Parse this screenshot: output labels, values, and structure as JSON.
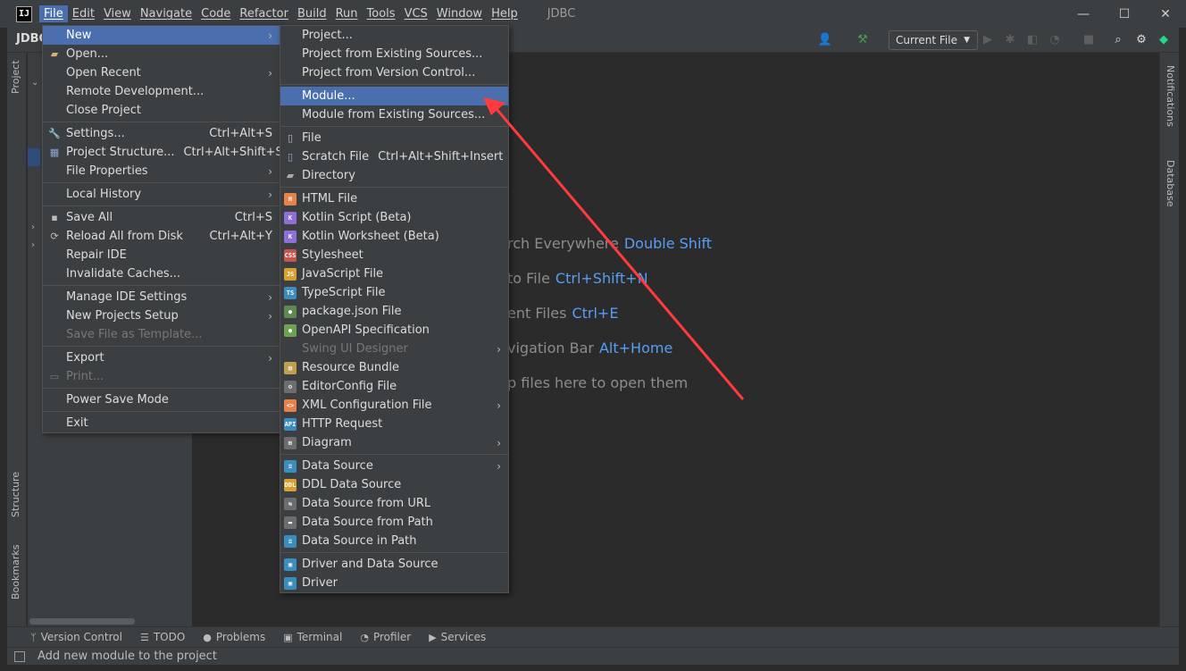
{
  "app": {
    "logo_text": "IJ",
    "window_title": "JDBC",
    "menus": [
      "File",
      "Edit",
      "View",
      "Navigate",
      "Code",
      "Refactor",
      "Build",
      "Run",
      "Tools",
      "VCS",
      "Window",
      "Help"
    ],
    "window_controls": {
      "minimize": "—",
      "maximize": "☐",
      "close": "✕"
    }
  },
  "toolbar": {
    "project_name": "JDBC",
    "run_config": "Current File"
  },
  "side_tabs": {
    "project": "Project",
    "structure": "Structure",
    "bookmarks": "Bookmarks",
    "notifications": "Notifications",
    "database": "Database"
  },
  "welcome_hints": [
    {
      "text": "rch Everywhere",
      "key": "Double Shift"
    },
    {
      "text": "to File",
      "key": "Ctrl+Shift+N"
    },
    {
      "text": "ent Files",
      "key": "Ctrl+E"
    },
    {
      "text": "vigation Bar",
      "key": "Alt+Home"
    },
    {
      "text": "p files here to open them",
      "key": ""
    }
  ],
  "file_menu": {
    "items": [
      {
        "label": "New",
        "shortcut": "",
        "submenu": true,
        "icon": "none",
        "selected": true
      },
      {
        "label": "Open...",
        "shortcut": "",
        "icon": "folder-icon"
      },
      {
        "label": "Open Recent",
        "shortcut": "",
        "submenu": true,
        "icon": "none"
      },
      {
        "label": "Remote Development...",
        "shortcut": "",
        "icon": "none"
      },
      {
        "label": "Close Project",
        "shortcut": "",
        "icon": "none"
      },
      {
        "sep": true
      },
      {
        "label": "Settings...",
        "shortcut": "Ctrl+Alt+S",
        "icon": "wrench-icon"
      },
      {
        "label": "Project Structure...",
        "shortcut": "Ctrl+Alt+Shift+S",
        "icon": "project-structure-icon"
      },
      {
        "label": "File Properties",
        "shortcut": "",
        "submenu": true,
        "icon": "none"
      },
      {
        "sep": true
      },
      {
        "label": "Local History",
        "shortcut": "",
        "submenu": true,
        "icon": "none"
      },
      {
        "sep": true
      },
      {
        "label": "Save All",
        "shortcut": "Ctrl+S",
        "icon": "save-icon"
      },
      {
        "label": "Reload All from Disk",
        "shortcut": "Ctrl+Alt+Y",
        "icon": "reload-icon"
      },
      {
        "label": "Repair IDE",
        "shortcut": "",
        "icon": "none"
      },
      {
        "label": "Invalidate Caches...",
        "shortcut": "",
        "icon": "none"
      },
      {
        "sep": true
      },
      {
        "label": "Manage IDE Settings",
        "shortcut": "",
        "submenu": true,
        "icon": "none"
      },
      {
        "label": "New Projects Setup",
        "shortcut": "",
        "submenu": true,
        "icon": "none"
      },
      {
        "label": "Save File as Template...",
        "shortcut": "",
        "icon": "none",
        "disabled": true
      },
      {
        "sep": true
      },
      {
        "label": "Export",
        "shortcut": "",
        "submenu": true,
        "icon": "none"
      },
      {
        "label": "Print...",
        "shortcut": "",
        "icon": "print-icon",
        "disabled": true
      },
      {
        "sep": true
      },
      {
        "label": "Power Save Mode",
        "shortcut": "",
        "icon": "none"
      },
      {
        "sep": true
      },
      {
        "label": "Exit",
        "shortcut": "",
        "icon": "none"
      }
    ]
  },
  "new_menu": {
    "items": [
      {
        "label": "Project...",
        "icon": "none"
      },
      {
        "label": "Project from Existing Sources...",
        "icon": "none"
      },
      {
        "label": "Project from Version Control...",
        "icon": "none"
      },
      {
        "sep": true
      },
      {
        "label": "Module...",
        "icon": "none",
        "selected": true
      },
      {
        "label": "Module from Existing Sources...",
        "icon": "none"
      },
      {
        "sep": true
      },
      {
        "label": "File",
        "icon": "file-icon"
      },
      {
        "label": "Scratch File",
        "shortcut": "Ctrl+Alt+Shift+Insert",
        "icon": "scratch-file-icon"
      },
      {
        "label": "Directory",
        "icon": "directory-icon"
      },
      {
        "sep": true
      },
      {
        "label": "HTML File",
        "icon": "html-file-icon",
        "badge": "H",
        "color": "#e8824a"
      },
      {
        "label": "Kotlin Script (Beta)",
        "icon": "kotlin-script-icon",
        "badge": "K",
        "color": "#8e6fd8"
      },
      {
        "label": "Kotlin Worksheet (Beta)",
        "icon": "kotlin-worksheet-icon",
        "badge": "K",
        "color": "#8e6fd8"
      },
      {
        "label": "Stylesheet",
        "icon": "stylesheet-icon",
        "badge": "CSS",
        "color": "#c75450"
      },
      {
        "label": "JavaScript File",
        "icon": "javascript-file-icon",
        "badge": "JS",
        "color": "#d8a031"
      },
      {
        "label": "TypeScript File",
        "icon": "typescript-file-icon",
        "badge": "TS",
        "color": "#3b8dbd"
      },
      {
        "label": "package.json File",
        "icon": "package-json-icon",
        "badge": "●",
        "color": "#5f8a4f"
      },
      {
        "label": "OpenAPI Specification",
        "icon": "openapi-icon",
        "badge": "●",
        "color": "#6ca351"
      },
      {
        "label": "Swing UI Designer",
        "icon": "none",
        "submenu": true,
        "disabled": true
      },
      {
        "label": "Resource Bundle",
        "icon": "resource-bundle-icon",
        "badge": "▥",
        "color": "#c0a050"
      },
      {
        "label": "EditorConfig File",
        "icon": "editorconfig-icon",
        "badge": "⚙",
        "color": "#6d6d6d"
      },
      {
        "label": "XML Configuration File",
        "icon": "xml-config-icon",
        "submenu": true,
        "badge": "<>",
        "color": "#e8824a"
      },
      {
        "label": "HTTP Request",
        "icon": "http-request-icon",
        "badge": "API",
        "color": "#3b8dbd"
      },
      {
        "label": "Diagram",
        "icon": "diagram-icon",
        "submenu": true,
        "badge": "⊞",
        "color": "#6d6d6d"
      },
      {
        "sep": true
      },
      {
        "label": "Data Source",
        "icon": "data-source-icon",
        "submenu": true,
        "badge": "≡",
        "color": "#3b8dbd"
      },
      {
        "label": "DDL Data Source",
        "icon": "ddl-data-source-icon",
        "badge": "DDL",
        "color": "#d8a031"
      },
      {
        "label": "Data Source from URL",
        "icon": "data-source-url-icon",
        "badge": "⇆",
        "color": "#6d6d6d"
      },
      {
        "label": "Data Source from Path",
        "icon": "data-source-path-icon",
        "badge": "▬",
        "color": "#6d6d6d"
      },
      {
        "label": "Data Source in Path",
        "icon": "data-source-in-path-icon",
        "badge": "≡",
        "color": "#3b8dbd"
      },
      {
        "sep": true
      },
      {
        "label": "Driver and Data Source",
        "icon": "driver-data-source-icon",
        "badge": "▣",
        "color": "#3b8dbd"
      },
      {
        "label": "Driver",
        "icon": "driver-icon",
        "badge": "▣",
        "color": "#3b8dbd"
      }
    ]
  },
  "bottom_tools": [
    {
      "label": "Version Control",
      "icon": "version-control-icon",
      "glyph": "ᛘ"
    },
    {
      "label": "TODO",
      "icon": "todo-icon",
      "glyph": "☰"
    },
    {
      "label": "Problems",
      "icon": "problems-icon",
      "glyph": "●"
    },
    {
      "label": "Terminal",
      "icon": "terminal-icon",
      "glyph": "▣"
    },
    {
      "label": "Profiler",
      "icon": "profiler-icon",
      "glyph": "◔"
    },
    {
      "label": "Services",
      "icon": "services-icon",
      "glyph": "▶"
    }
  ],
  "status": {
    "message": "Add new module to the project"
  },
  "colors": {
    "selection": "#4b6eaf",
    "annotation_arrow": "#ff3b3b",
    "link_key": "#589df6"
  }
}
